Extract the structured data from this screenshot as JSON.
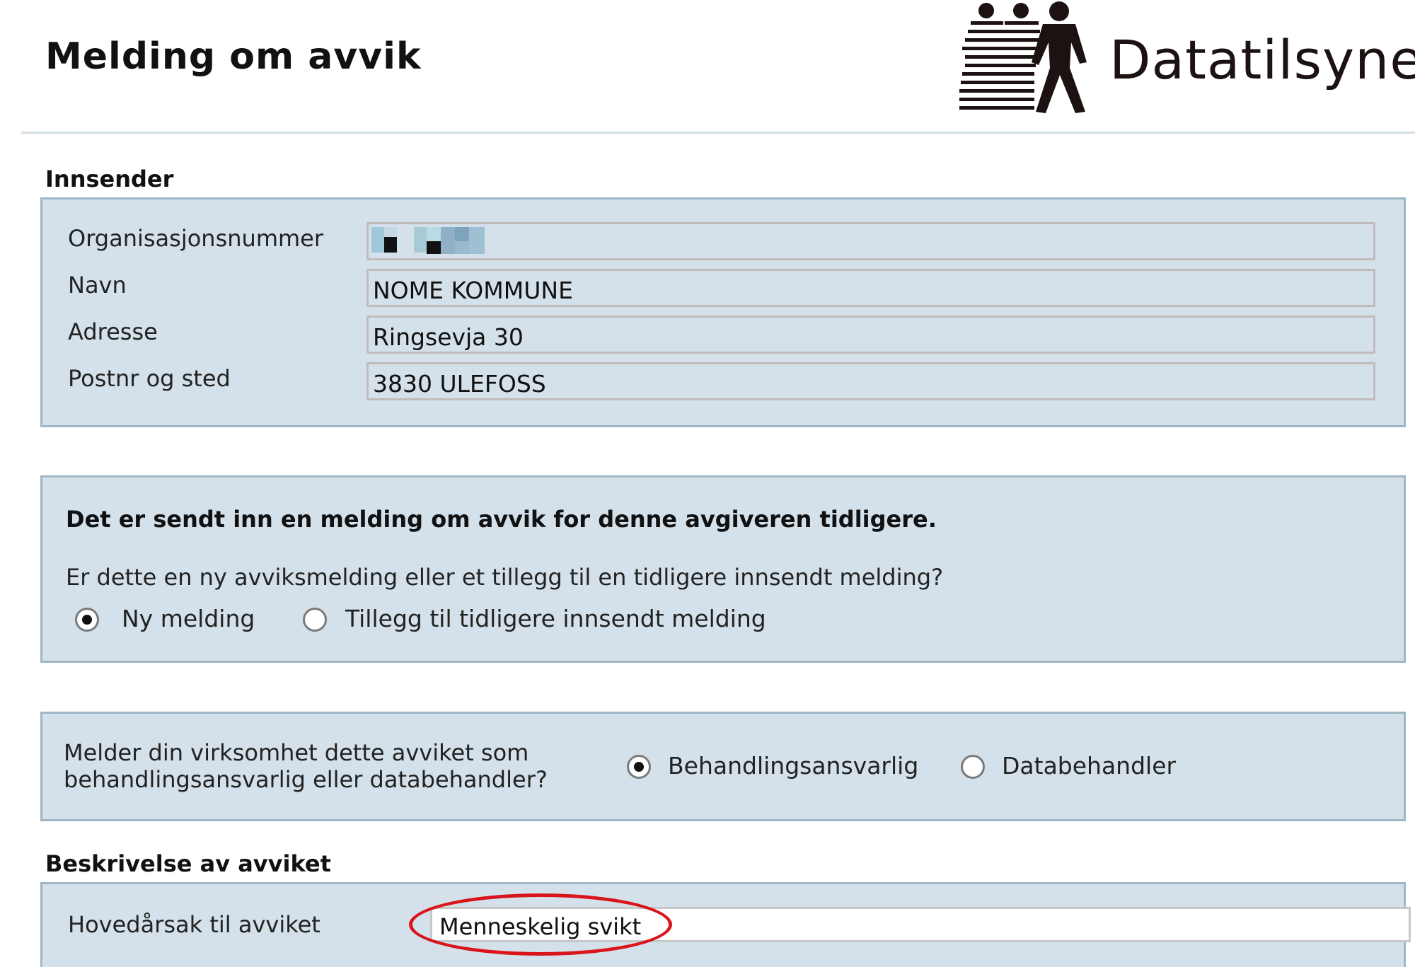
{
  "page": {
    "title": "Melding om avvik"
  },
  "logo": {
    "icon": "three-people-logo-icon",
    "text": "Datatilsynet"
  },
  "innsender": {
    "heading": "Innsender",
    "fields": [
      {
        "label": "Organisasjonsnummer",
        "value": ""
      },
      {
        "label": "Navn",
        "value": "NOME KOMMUNE"
      },
      {
        "label": "Adresse",
        "value": "Ringsevja 30"
      },
      {
        "label": "Postnr og sted",
        "value": "3830 ULEFOSS"
      }
    ]
  },
  "notice": {
    "title": "Det er sendt inn en melding om avvik for denne avgiveren tidligere.",
    "question": "Er dette en ny avviksmelding eller et tillegg til en tidligere innsendt melding?",
    "options": [
      {
        "label": "Ny melding",
        "checked": true
      },
      {
        "label": "Tillegg til tidligere innsendt melding",
        "checked": false
      }
    ]
  },
  "role": {
    "question_line1": "Melder din virksomhet dette avviket som",
    "question_line2": "behandlingsansvarlig eller databehandler?",
    "options": [
      {
        "label": "Behandlingsansvarlig",
        "checked": true
      },
      {
        "label": "Databehandler",
        "checked": false
      }
    ]
  },
  "beskrivelse": {
    "heading": "Beskrivelse av avviket",
    "cause_label": "Hovedårsak til avviket",
    "cause_value": "Menneskelig svikt"
  },
  "colors": {
    "panel_bg": "#d4e1ea",
    "panel_border": "#9fb6c7",
    "highlight": "#d9141b"
  }
}
